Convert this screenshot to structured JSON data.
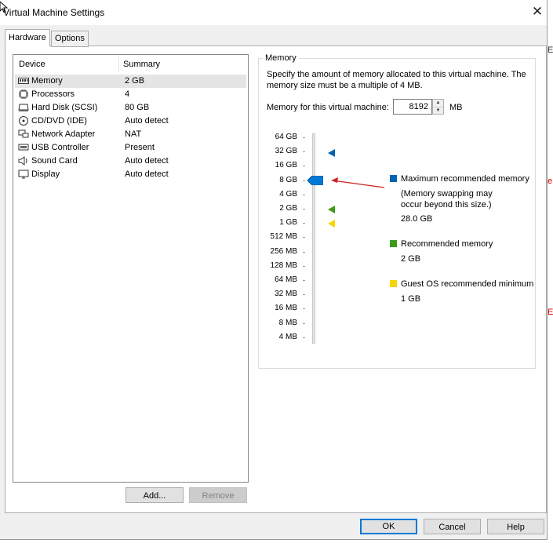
{
  "window": {
    "title": "Virtual Machine Settings"
  },
  "tabs": [
    {
      "label": "Hardware",
      "active": true
    },
    {
      "label": "Options",
      "active": false
    }
  ],
  "device_list": {
    "headers": {
      "device": "Device",
      "summary": "Summary"
    },
    "devices": [
      {
        "name": "Memory",
        "summary": "2 GB",
        "icon": "memory-icon",
        "selected": true
      },
      {
        "name": "Processors",
        "summary": "4",
        "icon": "processor-icon"
      },
      {
        "name": "Hard Disk (SCSI)",
        "summary": "80 GB",
        "icon": "hard-disk-icon"
      },
      {
        "name": "CD/DVD (IDE)",
        "summary": "Auto detect",
        "icon": "cd-dvd-icon"
      },
      {
        "name": "Network Adapter",
        "summary": "NAT",
        "icon": "network-adapter-icon"
      },
      {
        "name": "USB Controller",
        "summary": "Present",
        "icon": "usb-controller-icon"
      },
      {
        "name": "Sound Card",
        "summary": "Auto detect",
        "icon": "sound-card-icon"
      },
      {
        "name": "Display",
        "summary": "Auto detect",
        "icon": "display-icon"
      }
    ],
    "add_label": "Add...",
    "remove_label": "Remove"
  },
  "memory": {
    "group_title": "Memory",
    "description": "Specify the amount of memory allocated to this virtual machine. The memory size must be a multiple of 4 MB.",
    "field_label": "Memory for this virtual machine:",
    "value": "8192",
    "unit": "MB",
    "scale": [
      "64 GB",
      "32 GB",
      "16 GB",
      "8 GB",
      "4 GB",
      "2 GB",
      "1 GB",
      "512 MB",
      "256 MB",
      "128 MB",
      "64 MB",
      "32 MB",
      "16 MB",
      "8 MB",
      "4 MB"
    ],
    "slider_value": "8 GB",
    "legend": {
      "max": {
        "label": "Maximum recommended memory",
        "note_line1": "(Memory swapping may",
        "note_line2": "occur beyond this size.)",
        "value": "28.0 GB",
        "color": "#0063b1"
      },
      "recommended": {
        "label": "Recommended memory",
        "value": "2 GB",
        "color": "#3d9a1a"
      },
      "guest_min": {
        "label": "Guest OS recommended minimum",
        "value": "1 GB",
        "color": "#f5d400"
      }
    },
    "thumb_color": "#0078d7",
    "arrow_color": "#d02020"
  },
  "buttons": {
    "ok": "OK",
    "cancel": "Cancel",
    "help": "Help"
  },
  "edge_fragments": [
    "E",
    "e",
    "E"
  ]
}
